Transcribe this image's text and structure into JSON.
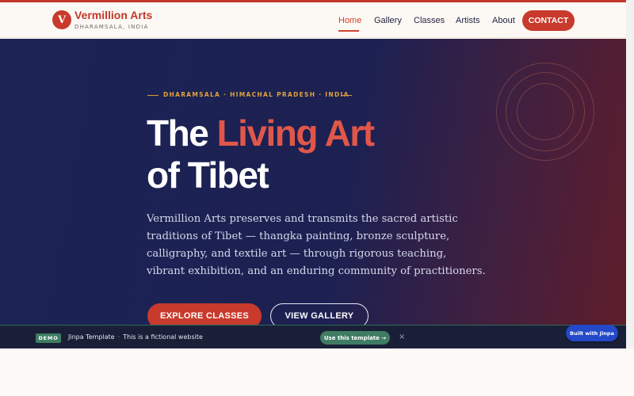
{
  "site": {
    "logo_letter": "V",
    "name": "Vermillion Arts",
    "location": "DHARAMSALA, INDIA"
  },
  "nav": {
    "items": [
      {
        "label": "Home",
        "active": true
      },
      {
        "label": "Gallery",
        "active": false
      },
      {
        "label": "Classes",
        "active": false
      },
      {
        "label": "Artists",
        "active": false
      },
      {
        "label": "About",
        "active": false
      }
    ],
    "contact_label": "CONTACT"
  },
  "hero": {
    "kicker": "DHARAMSALA · HIMACHAL PRADESH · INDIA",
    "title_part1": "The ",
    "title_accent": "Living Art",
    "title_line2": "of Tibet",
    "lead": "Vermillion Arts preserves and transmits the sacred artistic traditions of Tibet — thangka painting, bronze sculpture, calligraphy, and textile art — through rigorous teaching, vibrant exhibition, and an enduring community of practitioners.",
    "primary_cta": "EXPLORE CLASSES",
    "secondary_cta": "VIEW GALLERY"
  },
  "demo_bar": {
    "badge": "DEMO",
    "template_name": "Jinpa Template",
    "separator": "·",
    "note": "This is a fictional website",
    "use_label": "Use this template →",
    "close_icon": "×"
  },
  "built_with": "Built with Jinpa",
  "colors": {
    "brand_red": "#c83a2c",
    "navy": "#1b2254",
    "gold": "#e0a23a",
    "demo_green": "#3f7c63",
    "built_blue": "#2348c8"
  }
}
